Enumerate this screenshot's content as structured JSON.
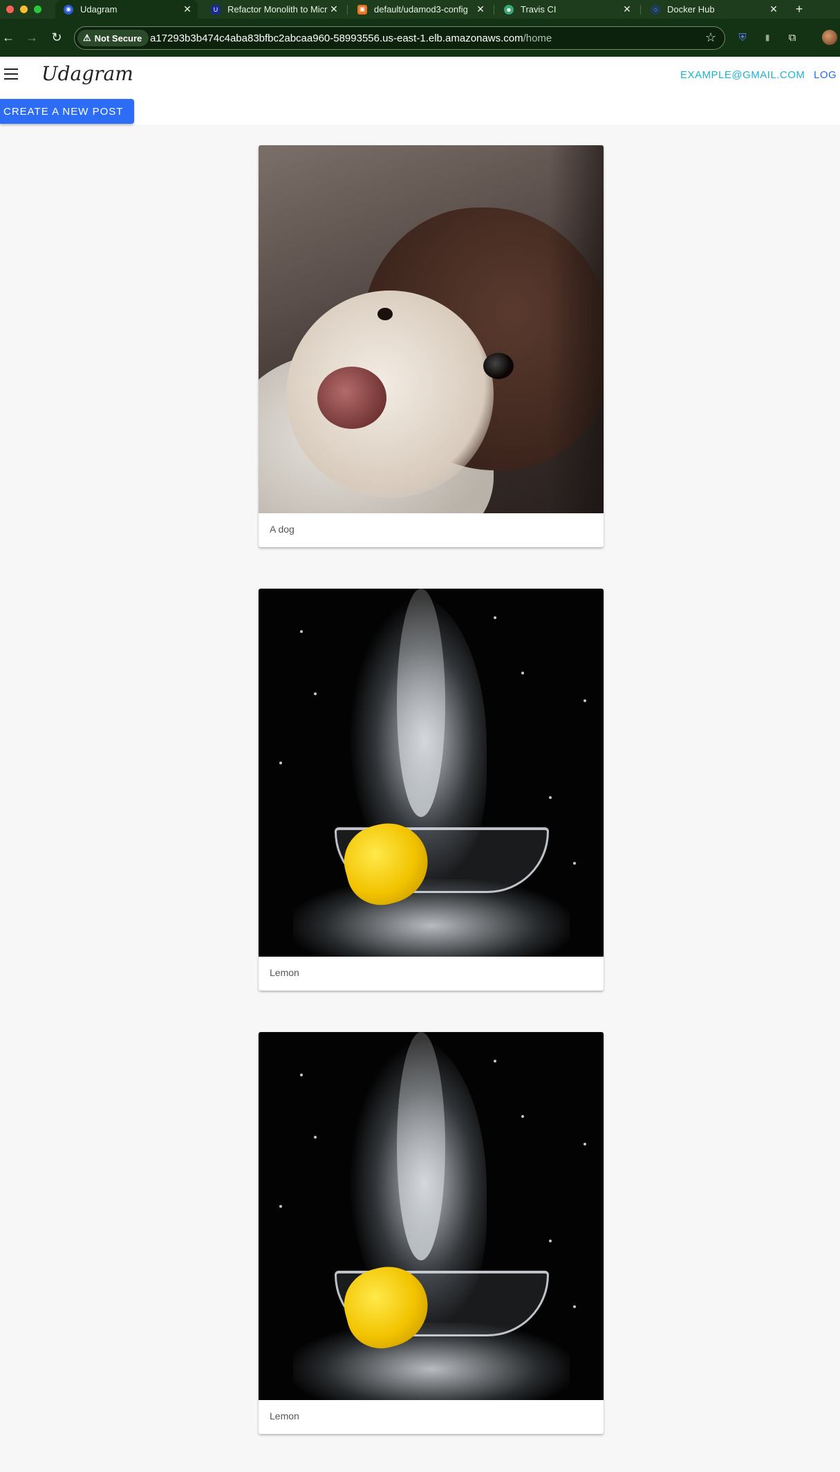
{
  "browser": {
    "tabs": [
      {
        "title": "Udagram",
        "active": true,
        "icon": "udagram-favicon"
      },
      {
        "title": "Refactor Monolith to Micr",
        "active": false,
        "icon": "udacity-favicon"
      },
      {
        "title": "default/udamod3-config",
        "active": false,
        "icon": "aws-favicon"
      },
      {
        "title": "Travis CI",
        "active": false,
        "icon": "travis-favicon"
      },
      {
        "title": "Docker Hub",
        "active": false,
        "icon": "docker-favicon"
      }
    ],
    "security_label": "Not Secure",
    "url_host": "a17293b3b474c4aba83bfbc2abcaa960-58993556.us-east-1.elb.amazonaws.com",
    "url_path": "/home"
  },
  "app": {
    "brand": "Udagram",
    "user_email": "EXAMPLE@GMAIL.COM",
    "logout_label": "LOG OUT",
    "create_post_label": "CREATE A NEW POST"
  },
  "posts": [
    {
      "caption": "A dog",
      "image": "dog-photo"
    },
    {
      "caption": "Lemon",
      "image": "lemon-splash-photo"
    },
    {
      "caption": "Lemon",
      "image": "lemon-splash-photo"
    }
  ]
}
